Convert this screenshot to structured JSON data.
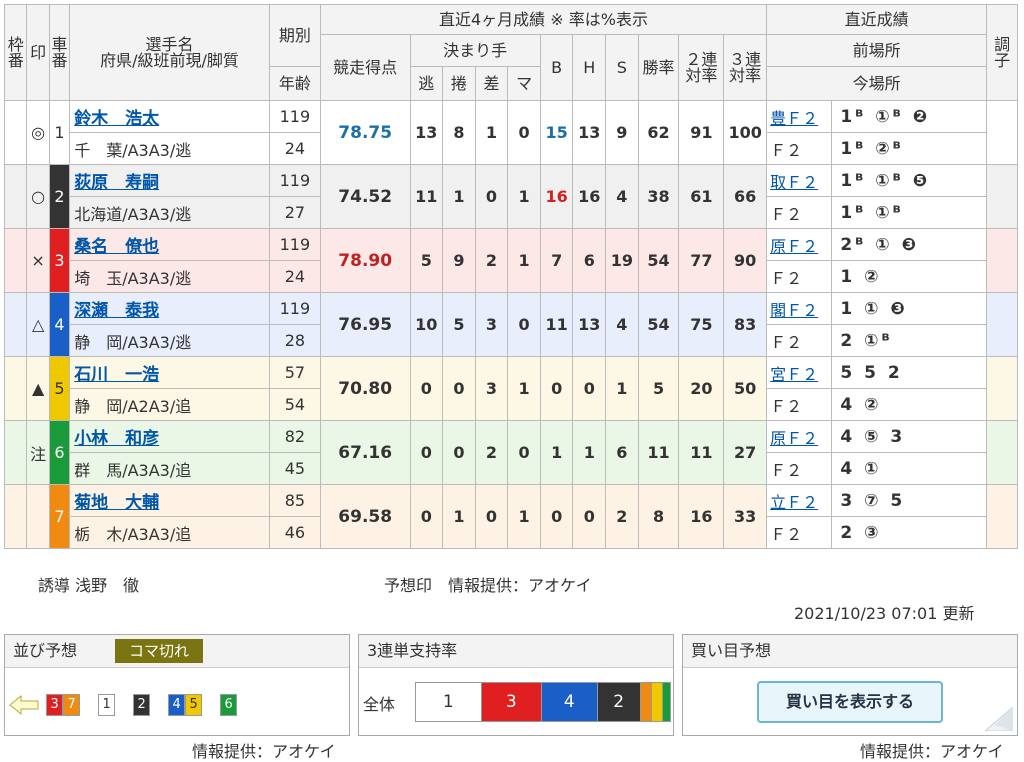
{
  "header": {
    "frame_no": "枠番",
    "mark": "印",
    "car_no": "車番",
    "player_name": "選手名",
    "player_sub": "府県/級班前現/脚質",
    "term": "期別",
    "age": "年齢",
    "recent4": "直近4ヶ月成績 ※ 率は%表示",
    "score": "競走得点",
    "kimarite": "決まり手",
    "nige": "逃",
    "makuri": "捲",
    "sashi": "差",
    "mark_k": "マ",
    "b": "B",
    "h": "H",
    "s": "S",
    "win_rate": "勝率",
    "rate2": "２連対率",
    "rate3": "３連対率",
    "recent": "直近成績",
    "prev": "前場所",
    "cur": "今場所",
    "cond": "調子"
  },
  "riders": [
    {
      "mark": "◎",
      "car": "1",
      "name": "鈴木　浩太",
      "pref": "千　葉/A3A3/逃",
      "term": "119",
      "age": "24",
      "score": "78.75",
      "nige": "13",
      "makuri": "8",
      "sashi": "1",
      "mk": "0",
      "b": "15",
      "h": "13",
      "s": "9",
      "win": "62",
      "r2": "91",
      "r3": "100",
      "prev_place": "豊Ｆ２",
      "prev_res": "1ᴮ ①ᴮ ❷",
      "cur_place": "Ｆ２",
      "cur_res": "1ᴮ ②ᴮ",
      "car_color": "#ffffff",
      "car_text": "#333333",
      "bg": "#ffffff",
      "score_color": "#1a6fa8",
      "b_color": "#1a6fa8"
    },
    {
      "mark": "○",
      "car": "2",
      "name": "荻原　寿嗣",
      "pref": "北海道/A3A3/逃",
      "term": "119",
      "age": "27",
      "score": "74.52",
      "nige": "11",
      "makuri": "1",
      "sashi": "0",
      "mk": "1",
      "b": "16",
      "h": "16",
      "s": "4",
      "win": "38",
      "r2": "61",
      "r3": "66",
      "prev_place": "取Ｆ２",
      "prev_res": "1ᴮ ①ᴮ ❺",
      "cur_place": "Ｆ２",
      "cur_res": "1ᴮ ①ᴮ",
      "car_color": "#333333",
      "car_text": "#ffffff",
      "bg": "#f0f0f0",
      "score_color": "#333333",
      "b_color": "#d42020"
    },
    {
      "mark": "×",
      "car": "3",
      "name": "桑名　僚也",
      "pref": "埼　玉/A3A3/逃",
      "term": "119",
      "age": "24",
      "score": "78.90",
      "nige": "5",
      "makuri": "9",
      "sashi": "2",
      "mk": "1",
      "b": "7",
      "h": "6",
      "s": "19",
      "win": "54",
      "r2": "77",
      "r3": "90",
      "prev_place": "原Ｆ２",
      "prev_res": "2ᴮ ①  ❸",
      "cur_place": "Ｆ２",
      "cur_res": "1  ②",
      "car_color": "#e02020",
      "car_text": "#ffffff",
      "bg": "#fde8e8",
      "score_color": "#c02020",
      "b_color": "#333333"
    },
    {
      "mark": "△",
      "car": "4",
      "name": "深瀬　泰我",
      "pref": "静　岡/A3A3/逃",
      "term": "119",
      "age": "28",
      "score": "76.95",
      "nige": "10",
      "makuri": "5",
      "sashi": "3",
      "mk": "0",
      "b": "11",
      "h": "13",
      "s": "4",
      "win": "54",
      "r2": "75",
      "r3": "83",
      "prev_place": "閣Ｆ２",
      "prev_res": "1  ①  ❸",
      "cur_place": "Ｆ２",
      "cur_res": "2  ①ᴮ",
      "car_color": "#1a5fc8",
      "car_text": "#ffffff",
      "bg": "#e8eefc",
      "score_color": "#333333",
      "b_color": "#333333"
    },
    {
      "mark": "▲",
      "car": "5",
      "name": "石川　一浩",
      "pref": "静　岡/A2A3/追",
      "term": "57",
      "age": "54",
      "score": "70.80",
      "nige": "0",
      "makuri": "0",
      "sashi": "3",
      "mk": "1",
      "b": "0",
      "h": "0",
      "s": "1",
      "win": "5",
      "r2": "20",
      "r3": "50",
      "prev_place": "宮Ｆ２",
      "prev_res": "5  5  2",
      "cur_place": "Ｆ２",
      "cur_res": "4  ②",
      "car_color": "#f0c800",
      "car_text": "#333333",
      "bg": "#fdf8e6",
      "score_color": "#333333",
      "b_color": "#333333"
    },
    {
      "mark": "注",
      "car": "6",
      "name": "小林　和彦",
      "pref": "群　馬/A3A3/追",
      "term": "82",
      "age": "45",
      "score": "67.16",
      "nige": "0",
      "makuri": "0",
      "sashi": "2",
      "mk": "0",
      "b": "1",
      "h": "1",
      "s": "6",
      "win": "11",
      "r2": "11",
      "r3": "27",
      "prev_place": "原Ｆ２",
      "prev_res": "4  ⑤  3",
      "cur_place": "Ｆ２",
      "cur_res": "4  ①",
      "car_color": "#1a9a3a",
      "car_text": "#ffffff",
      "bg": "#eaf6e6",
      "score_color": "#333333",
      "b_color": "#333333"
    },
    {
      "mark": "",
      "car": "7",
      "name": "菊地　大輔",
      "pref": "栃　木/A3A3/追",
      "term": "85",
      "age": "46",
      "score": "69.58",
      "nige": "0",
      "makuri": "1",
      "sashi": "0",
      "mk": "1",
      "b": "0",
      "h": "0",
      "s": "2",
      "win": "8",
      "r2": "16",
      "r3": "33",
      "prev_place": "立Ｆ２",
      "prev_res": "3  ⑦  5",
      "cur_place": "Ｆ２",
      "cur_res": "2  ③",
      "car_color": "#f08a10",
      "car_text": "#ffffff",
      "bg": "#fdf2e4",
      "score_color": "#333333",
      "b_color": "#333333"
    }
  ],
  "footer": {
    "leader": "誘導 浅野　徹",
    "yoso_mark": "予想印　情報提供：アオケイ",
    "updated": "2021/10/23 07:01 更新",
    "credit1": "情報提供：アオケイ",
    "credit2": "情報提供：アオケイ"
  },
  "narabi": {
    "title": "並び予想",
    "badge": "コマ切れ",
    "arrow_icon": "arrow-left-icon",
    "groups": [
      [
        {
          "n": "3",
          "bg": "#e02020",
          "fg": "#ffffff"
        },
        {
          "n": "7",
          "bg": "#f08a10",
          "fg": "#ffffff"
        }
      ],
      [
        {
          "n": "1",
          "bg": "#ffffff",
          "fg": "#333333"
        }
      ],
      [
        {
          "n": "2",
          "bg": "#333333",
          "fg": "#ffffff"
        }
      ],
      [
        {
          "n": "4",
          "bg": "#1a5fc8",
          "fg": "#ffffff"
        },
        {
          "n": "5",
          "bg": "#f0c800",
          "fg": "#333333"
        }
      ],
      [
        {
          "n": "6",
          "bg": "#1a9a3a",
          "fg": "#ffffff"
        }
      ]
    ]
  },
  "support": {
    "title": "3連単支持率",
    "label": "全体",
    "segments": [
      {
        "n": "1",
        "bg": "#ffffff",
        "fg": "#333333",
        "share": 0.26
      },
      {
        "n": "3",
        "bg": "#e02020",
        "fg": "#ffffff",
        "share": 0.24
      },
      {
        "n": "4",
        "bg": "#1a5fc8",
        "fg": "#ffffff",
        "share": 0.22
      },
      {
        "n": "2",
        "bg": "#333333",
        "fg": "#ffffff",
        "share": 0.17
      },
      {
        "n": "",
        "bg": "#f08a10",
        "fg": "#ffffff",
        "share": 0.04
      },
      {
        "n": "",
        "bg": "#f0c800",
        "fg": "#333333",
        "share": 0.04
      },
      {
        "n": "",
        "bg": "#1a9a3a",
        "fg": "#ffffff",
        "share": 0.03
      }
    ]
  },
  "kaime": {
    "title": "買い目予想",
    "button": "買い目を表示する"
  }
}
